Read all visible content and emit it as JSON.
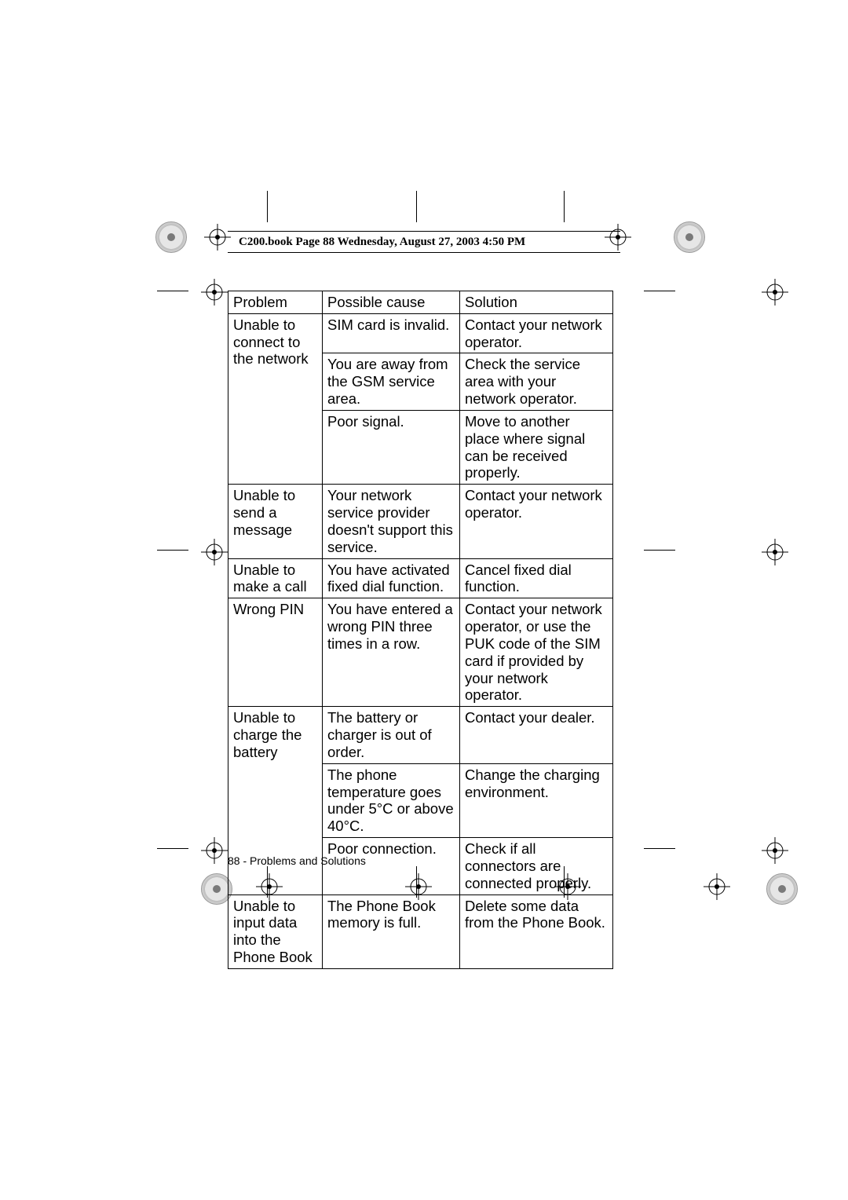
{
  "header": "C200.book  Page 88  Wednesday, August 27, 2003  4:50 PM",
  "table": {
    "headers": [
      "Problem",
      "Possible cause",
      "Solution"
    ],
    "rows": [
      {
        "problem": "Unable to connect to the network",
        "problem_rowspan": 3,
        "cause": "SIM card is invalid.",
        "solution": "Contact your network operator."
      },
      {
        "cause": "You are away from the GSM service area.",
        "solution": "Check the service area with your network operator."
      },
      {
        "cause": "Poor signal.",
        "solution": "Move to another place where signal can be received properly."
      },
      {
        "problem": "Unable to send a message",
        "problem_rowspan": 1,
        "cause": "Your network service provider doesn't support this service.",
        "solution": "Contact your network operator."
      },
      {
        "problem": "Unable to make a call",
        "problem_rowspan": 1,
        "cause": "You have activated fixed dial function.",
        "solution": "Cancel fixed dial function."
      },
      {
        "problem": "Wrong PIN",
        "problem_rowspan": 1,
        "cause": "You have entered a wrong PIN three times in a row.",
        "solution": "Contact your network operator, or use the PUK code of the SIM card if provided by your network operator."
      },
      {
        "problem": "Unable to charge the battery",
        "problem_rowspan": 3,
        "cause": "The battery or charger is out of order.",
        "solution": "Contact your dealer."
      },
      {
        "cause": "The phone temperature goes under 5°C or above 40°C.",
        "solution": "Change the charging environment."
      },
      {
        "cause": "Poor connection.",
        "solution": "Check if all connectors are connected properly."
      },
      {
        "problem": "Unable to input data into the Phone Book",
        "problem_rowspan": 1,
        "cause": "The Phone Book memory is full.",
        "solution": "Delete some data from the Phone Book."
      }
    ]
  },
  "footer": "88 - Problems and Solutions"
}
